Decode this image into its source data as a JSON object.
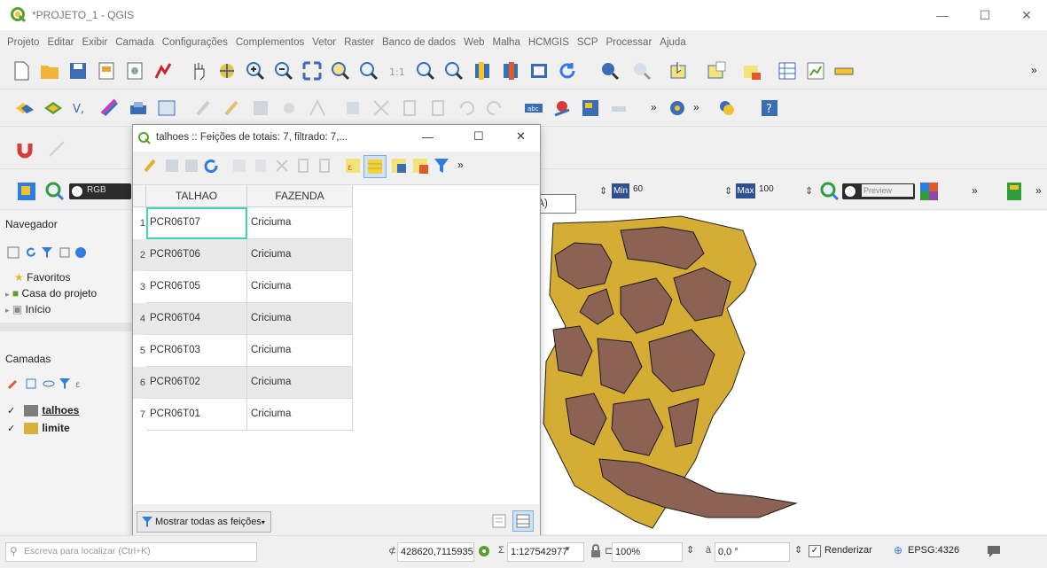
{
  "window": {
    "title": "*PROJETO_1 - QGIS"
  },
  "menu": [
    "Projeto",
    "Editar",
    "Exibir",
    "Camada",
    "Configurações",
    "Complementos",
    "Vetor",
    "Raster",
    "Banco de dados",
    "Web",
    "Malha",
    "HCMGIS",
    "SCP",
    "Processar",
    "Ajuda"
  ],
  "raster_toolbar": {
    "rgb_label": "RGB",
    "min_label": "Min",
    "min_value": "60",
    "max_label": "Max",
    "max_value": "100",
    "preview_label": "Preview",
    "more": "»"
  },
  "tooltip": "Selecionar todas (Ctrl+A)",
  "navigator": {
    "title": "Navegador",
    "items": [
      "Favoritos",
      "Casa do projeto",
      "Início"
    ]
  },
  "layers": {
    "title": "Camadas",
    "items": [
      {
        "name": "talhoes",
        "color": "#7d7d7d",
        "checked": "✓"
      },
      {
        "name": "limite",
        "color": "#d9b13a",
        "checked": "✓"
      }
    ]
  },
  "attr_dialog": {
    "title": "talhoes :: Feições de totais: 7, filtrado: 7,...",
    "columns": [
      "TALHAO",
      "FAZENDA"
    ],
    "rows": [
      {
        "num": "1",
        "talhao": "PCR06T07",
        "fazenda": "Criciuma"
      },
      {
        "num": "2",
        "talhao": "PCR06T06",
        "fazenda": "Criciuma"
      },
      {
        "num": "3",
        "talhao": "PCR06T05",
        "fazenda": "Criciuma"
      },
      {
        "num": "4",
        "talhao": "PCR06T04",
        "fazenda": "Criciuma"
      },
      {
        "num": "5",
        "talhao": "PCR06T03",
        "fazenda": "Criciuma"
      },
      {
        "num": "6",
        "talhao": "PCR06T02",
        "fazenda": "Criciuma"
      },
      {
        "num": "7",
        "talhao": "PCR06T01",
        "fazenda": "Criciuma"
      }
    ],
    "filter_button": "Mostrar todas as feições",
    "more": "»"
  },
  "status": {
    "search_placeholder": "Escreva para localizar (Ctrl+K)",
    "coord_prefix": "⊄",
    "coordinate": "428620,7115935",
    "scale_prefix": "Σ",
    "scale": "1:127542977",
    "mag_prefix": "⊏",
    "magnifier": "100%",
    "rotation_prefix": "à",
    "rotation": "0,0 °",
    "render_label": "Renderizar",
    "crs": "EPSG:4326"
  },
  "colors": {
    "talhao_fill": "#8c6254",
    "limite_fill": "#d5ad35",
    "selection": "#3dd6b3"
  }
}
